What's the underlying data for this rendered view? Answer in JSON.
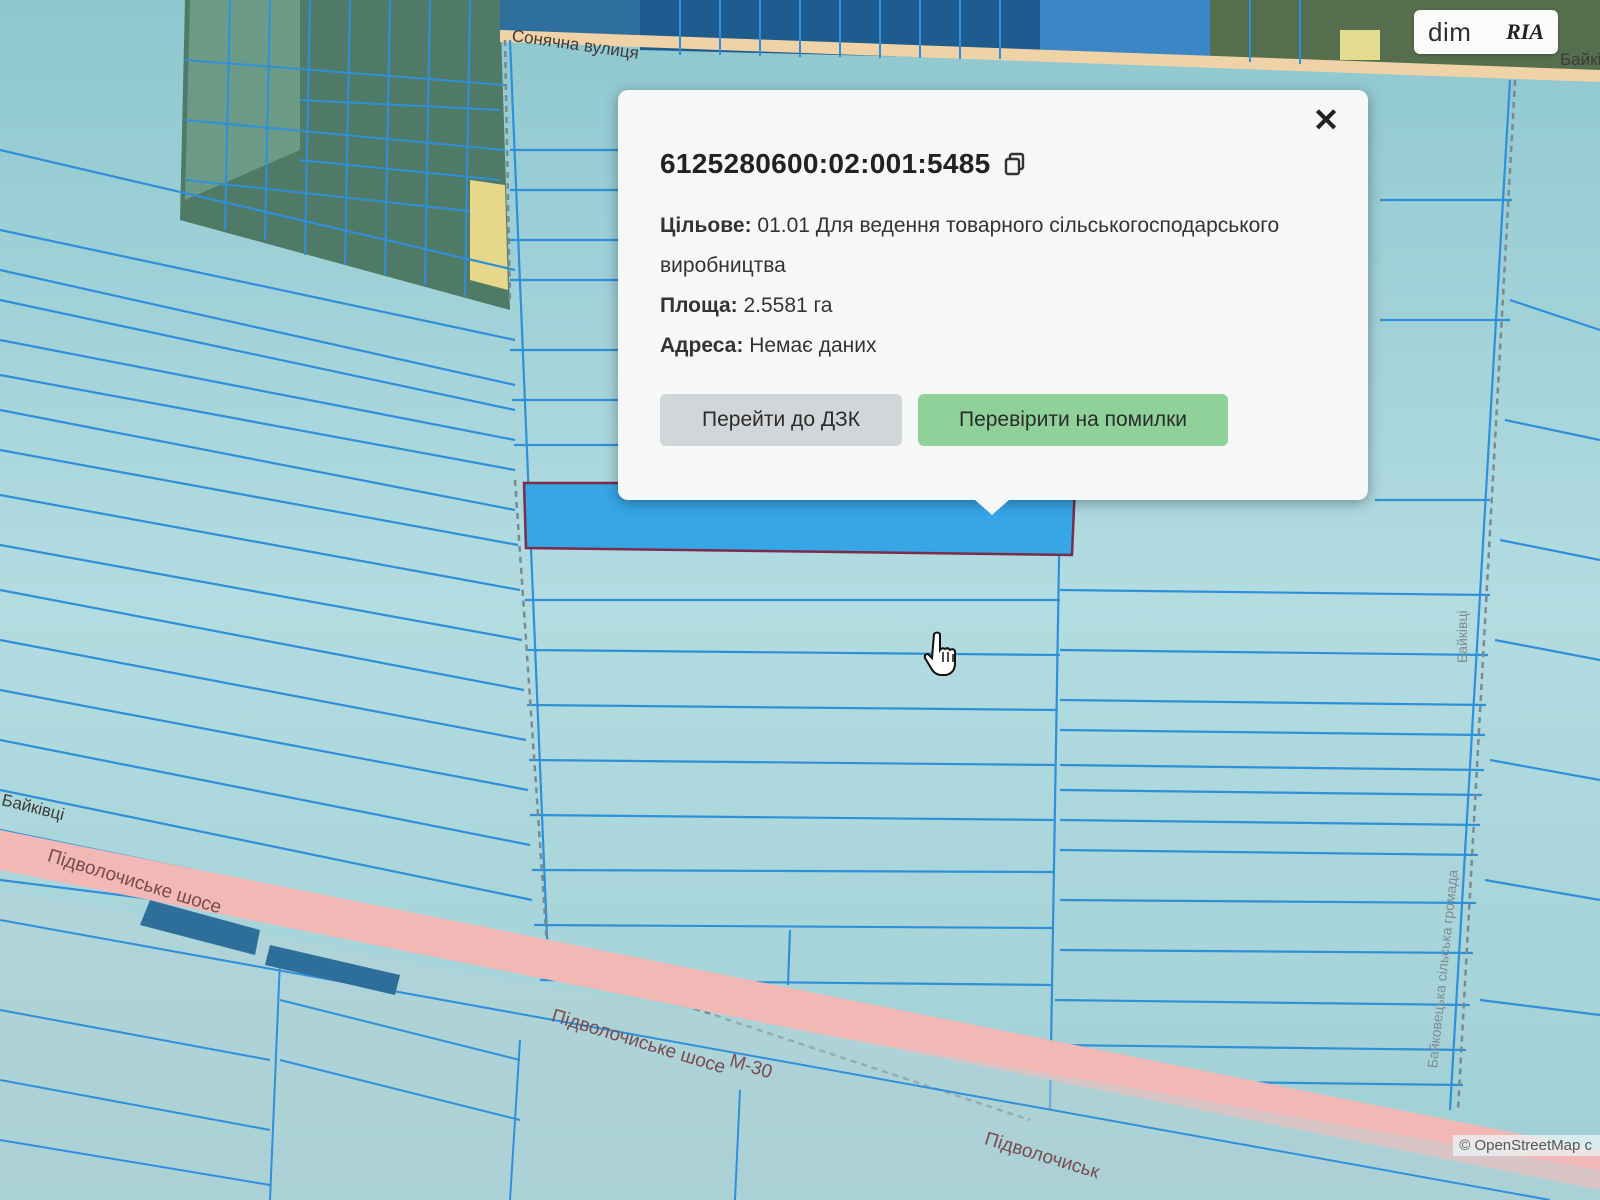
{
  "map": {
    "street_labels": [
      "Сонячна вулиця",
      "Байківці",
      "Байківці",
      "Байківці"
    ],
    "road_labels": [
      "Підволочиське шосе",
      "Підволочиське шосе",
      "М-30",
      "Підволочиськ"
    ],
    "community_label": "Байковецька сільська громада",
    "attribution": "© OpenStreetMap c",
    "colors": {
      "background": "#a9d6dc",
      "parcel_line": "#2f8fd8",
      "selected_parcel_fill": "#36a6e6",
      "selected_parcel_border": "#7a2c4a",
      "road": "#f2b8b5",
      "village_area": "#5f7f6a"
    }
  },
  "logo": {
    "left": "dim",
    "right": "RIA"
  },
  "popup": {
    "cadastral_number": "6125280600:02:001:5485",
    "purpose_label": "Цільове:",
    "purpose_value": "01.01 Для ведення товарного сільськогосподарського виробництва",
    "area_label": "Площа:",
    "area_value": "2.5581 га",
    "address_label": "Адреса:",
    "address_value": "Немає даних",
    "button_dzk": "Перейти до ДЗК",
    "button_check": "Перевірити на помилки",
    "close_symbol": "✕"
  },
  "icons": [
    "copy-icon",
    "close-icon",
    "hand-cursor-icon"
  ]
}
